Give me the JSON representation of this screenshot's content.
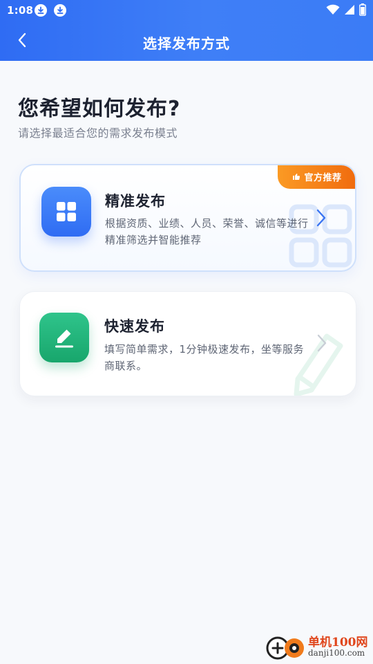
{
  "status": {
    "time": "1:08",
    "icons": [
      "download-icon",
      "download-icon",
      "wifi-icon",
      "signal-icon",
      "battery-icon"
    ]
  },
  "nav": {
    "title": "选择发布方式",
    "back_icon": "chevron-left-icon"
  },
  "heading": {
    "title": "您希望如何发布?",
    "subtitle": "请选择最适合您的需求发布模式"
  },
  "cards": [
    {
      "title": "精准发布",
      "desc": "根据资质、业绩、人员、荣誉、诚信等进行精准筛选并智能推荐",
      "icon": "grid-icon",
      "badge": "官方推荐",
      "badge_icon": "thumbs-up-icon",
      "accent": "#2f6cf3"
    },
    {
      "title": "快速发布",
      "desc": "填写简单需求，1分钟极速发布，坐等服务商联系。",
      "icon": "pencil-icon",
      "accent": "#18a66c"
    }
  ],
  "watermark": {
    "name": "单机100网",
    "domain": "danji100.com"
  },
  "colors": {
    "primary": "#2f6cf3",
    "badge": "#f47a12",
    "green": "#18a66c",
    "text": "#1d2230",
    "muted": "#7b8190"
  }
}
